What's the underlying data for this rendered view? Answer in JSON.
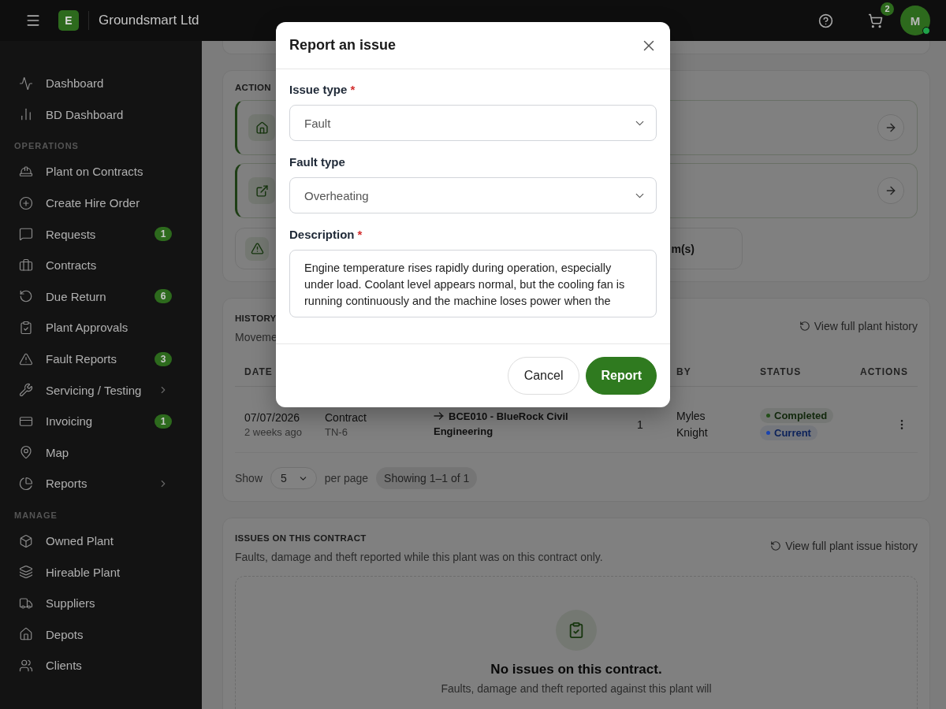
{
  "topbar": {
    "logo": "E",
    "company": "Groundsmart Ltd",
    "cart_count": "2",
    "avatar": "M",
    "online": true
  },
  "sidebar": {
    "top_items": [
      {
        "label": "Dashboard",
        "submenu": false
      },
      {
        "label": "BD Dashboard",
        "submenu": false
      }
    ],
    "sections": [
      {
        "title": "OPERATIONS",
        "items": [
          {
            "label": "Plant on Contracts",
            "submenu": false
          },
          {
            "label": "Create Hire Order",
            "submenu": false
          },
          {
            "label": "Requests",
            "badge": "1",
            "submenu": false
          },
          {
            "label": "Contracts",
            "submenu": false
          },
          {
            "label": "Due Return",
            "badge": "6",
            "submenu": false
          },
          {
            "label": "Plant Approvals",
            "submenu": false
          },
          {
            "label": "Fault Reports",
            "badge": "3",
            "submenu": false
          },
          {
            "label": "Servicing / Testing",
            "submenu": true
          },
          {
            "label": "Invoicing",
            "badge": "1",
            "submenu": false
          },
          {
            "label": "Map",
            "submenu": false
          },
          {
            "label": "Reports",
            "submenu": true
          }
        ]
      },
      {
        "title": "MANAGE",
        "items": [
          {
            "label": "Owned Plant",
            "submenu": false
          },
          {
            "label": "Hireable Plant",
            "submenu": false
          },
          {
            "label": "Suppliers",
            "submenu": false
          },
          {
            "label": "Depots",
            "submenu": false
          },
          {
            "label": "Clients",
            "submenu": false
          }
        ]
      }
    ]
  },
  "actions": {
    "title": "ACTION",
    "items": [
      {
        "kind": "link"
      },
      {
        "kind": "link"
      },
      {
        "kind": "alert",
        "text": "m(s)"
      }
    ]
  },
  "history": {
    "title": "HISTORY",
    "subtitle": "Moveme",
    "link": "View full plant history",
    "columns": [
      "DATE",
      "BY",
      "STATUS",
      "ACTIONS"
    ],
    "rows": [
      {
        "date": "07/07/2026",
        "ago": "2 weeks ago",
        "type": "Contract",
        "ref": "TN-6",
        "route": "BCE010 - BlueRock Civil Engineering",
        "qty": "1",
        "by": "Myles Knight",
        "statuses": [
          {
            "label": "Completed",
            "color": "#24501a"
          },
          {
            "label": "Current",
            "color": "#1a44b0"
          }
        ]
      }
    ],
    "pagination": {
      "show": "Show",
      "per_page": "5",
      "per_page_label": "per page",
      "summary": "Showing 1–1 of 1"
    }
  },
  "issues": {
    "title": "ISSUES ON THIS CONTRACT",
    "subtitle": "Faults, damage and theft reported while this plant was on this contract only.",
    "link": "View full plant issue history",
    "empty_title": "No issues on this contract.",
    "empty_text": "Faults, damage and theft reported against this plant will"
  },
  "modal": {
    "title": "Report an issue",
    "fields": [
      {
        "kind": "select",
        "label": "Issue type",
        "required_mark": "*",
        "value": "Fault"
      },
      {
        "kind": "select",
        "label": "Fault type",
        "value": "Overheating"
      },
      {
        "kind": "textarea",
        "label": "Description",
        "required_mark": "*",
        "value": "Engine temperature rises rapidly during operation, especially under load. Coolant level appears normal, but the cooling fan is running continuously and the machine loses power when the"
      }
    ],
    "buttons": [
      {
        "label": "Cancel",
        "primary": false
      },
      {
        "label": "Report",
        "primary": true
      }
    ]
  }
}
